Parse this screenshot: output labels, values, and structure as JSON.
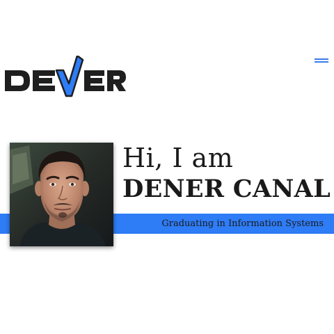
{
  "logo": {
    "alt": "DENER"
  },
  "menu": {
    "icon": "hamburger-menu-icon",
    "aria_label": "Menu"
  },
  "hero": {
    "greeting": "Hi, I am",
    "name": "DENER CANAL",
    "subtitle": "Graduating in Information Systems",
    "photo_alt": "Profile photo"
  },
  "colors": {
    "accent": "#2e7cf6",
    "logo_dark": "#1f1f1f",
    "text": "#1a1a1a"
  }
}
